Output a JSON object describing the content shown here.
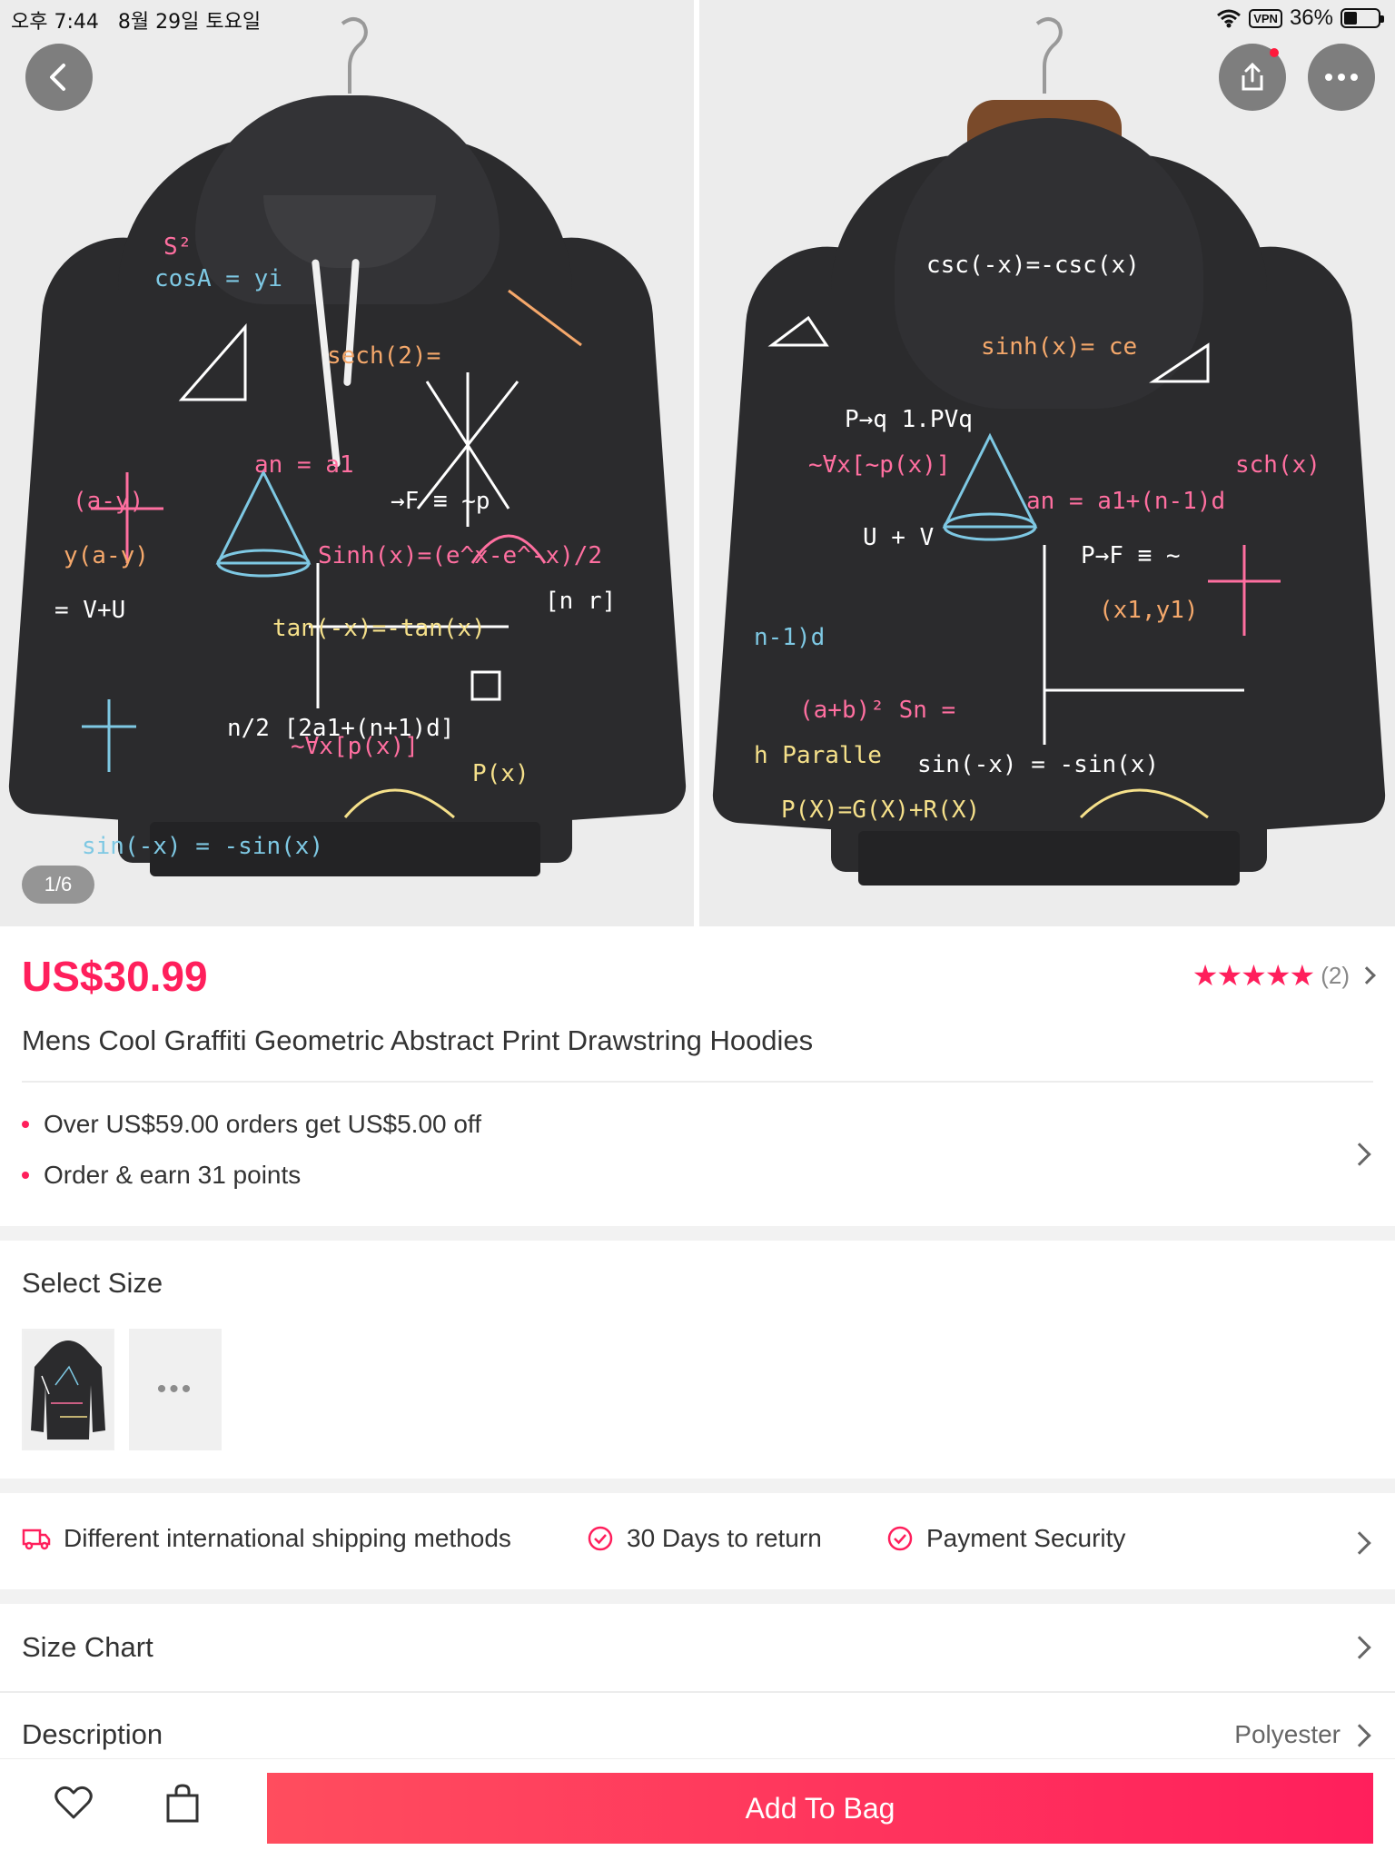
{
  "status_bar": {
    "time": "오후 7:44",
    "date": "8월 29일 토요일",
    "vpn": "VPN",
    "battery": "36%"
  },
  "gallery": {
    "page_indicator": "1/6",
    "icons": [
      "back-icon",
      "share-icon",
      "more-icon"
    ]
  },
  "product": {
    "price": "US$30.99",
    "stars": "★★★★★",
    "review_count": "(2)",
    "title": "Mens Cool Graffiti Geometric Abstract Print Drawstring Hoodies"
  },
  "promotions": [
    "Over US$59.00 orders get US$5.00 off",
    "Order & earn 31 points"
  ],
  "size": {
    "title": "Select Size",
    "more": "•••"
  },
  "services": [
    {
      "label": "Different international shipping methods",
      "icon": "truck-icon"
    },
    {
      "label": "30 Days to return",
      "icon": "check-circle-icon"
    },
    {
      "label": "Payment Security",
      "icon": "check-circle-icon"
    }
  ],
  "size_chart": {
    "title": "Size Chart"
  },
  "description": {
    "title": "Description",
    "value": "Polyester"
  },
  "footer": {
    "add_to_bag": "Add To Bag"
  },
  "colors": {
    "accent": "#ff1f5c",
    "button_start": "#ff4d5e",
    "button_end": "#ff1f5c"
  }
}
